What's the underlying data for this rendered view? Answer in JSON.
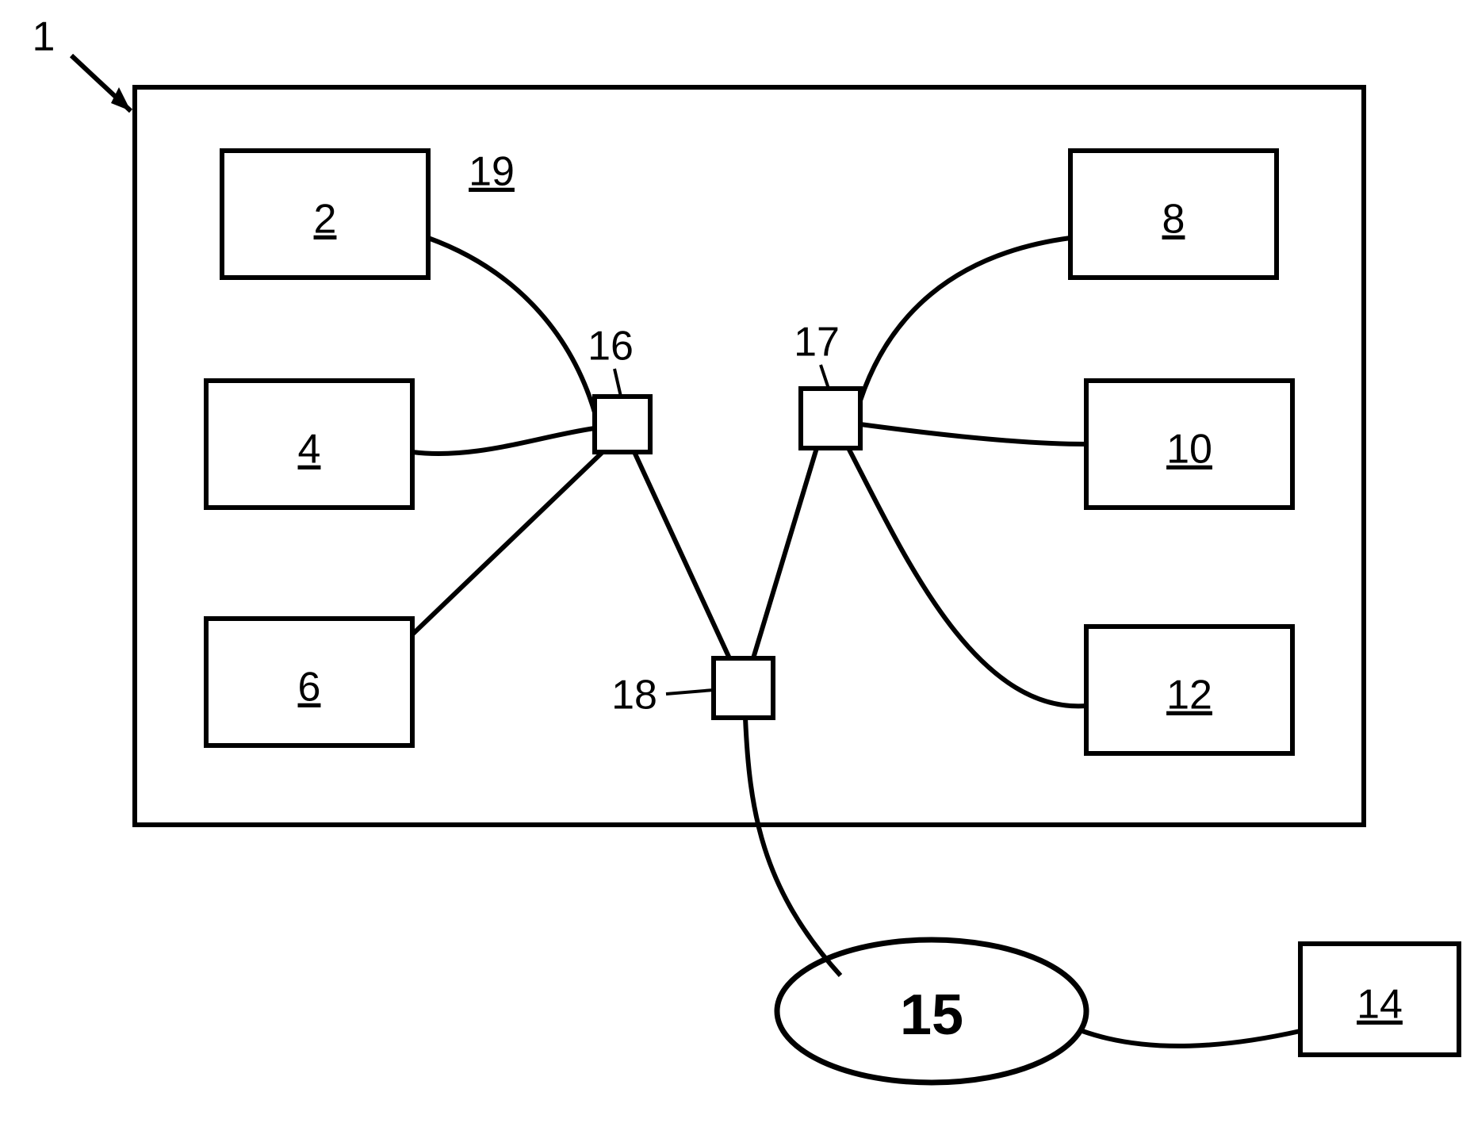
{
  "figure": {
    "title_label": "1",
    "frame_label": "19",
    "left_boxes": [
      {
        "id": "box-2",
        "label": "2"
      },
      {
        "id": "box-4",
        "label": "4"
      },
      {
        "id": "box-6",
        "label": "6"
      }
    ],
    "right_boxes": [
      {
        "id": "box-8",
        "label": "8"
      },
      {
        "id": "box-10",
        "label": "10"
      },
      {
        "id": "box-12",
        "label": "12"
      }
    ],
    "junctions": {
      "left": {
        "id": "junction-16",
        "label": "16"
      },
      "right": {
        "id": "junction-17",
        "label": "17"
      },
      "bottom": {
        "id": "junction-18",
        "label": "18"
      }
    },
    "external_box": {
      "id": "box-14",
      "label": "14"
    },
    "oval": {
      "id": "oval-15",
      "label": "15"
    }
  }
}
